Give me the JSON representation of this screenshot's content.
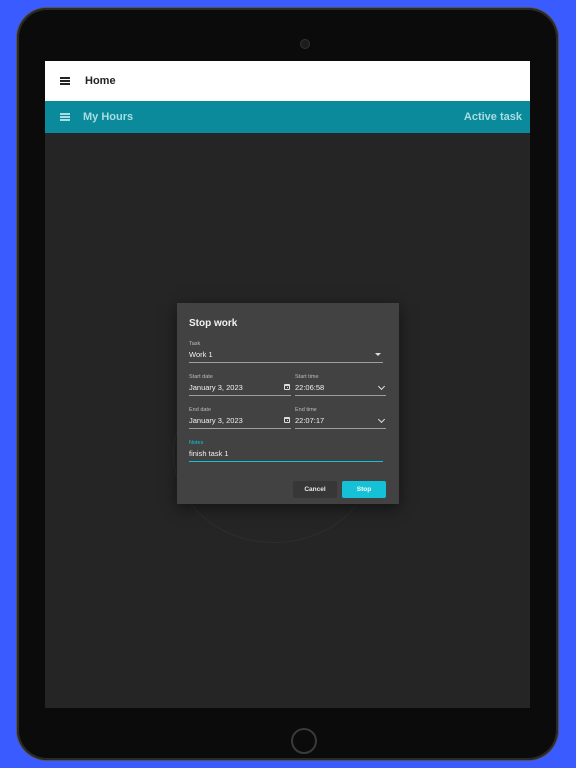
{
  "topbar": {
    "title": "Home",
    "menu_icon": "hamburger-menu-icon"
  },
  "appbar": {
    "title": "My Hours",
    "action": "Active task",
    "menu_icon": "hamburger-menu-icon",
    "color": "#0a8a9a"
  },
  "dialog": {
    "title": "Stop work",
    "task": {
      "label": "Task",
      "value": "Work 1"
    },
    "start_date": {
      "label": "Start date",
      "value": "January 3, 2023"
    },
    "start_time": {
      "label": "Start time",
      "value": "22:06:58"
    },
    "end_date": {
      "label": "End date",
      "value": "January 3, 2023"
    },
    "end_time": {
      "label": "End time",
      "value": "22:07:17"
    },
    "notes": {
      "label": "Notes",
      "value": "finish task 1"
    },
    "cancel_label": "Cancel",
    "stop_label": "Stop",
    "accent": "#14c1d6"
  }
}
